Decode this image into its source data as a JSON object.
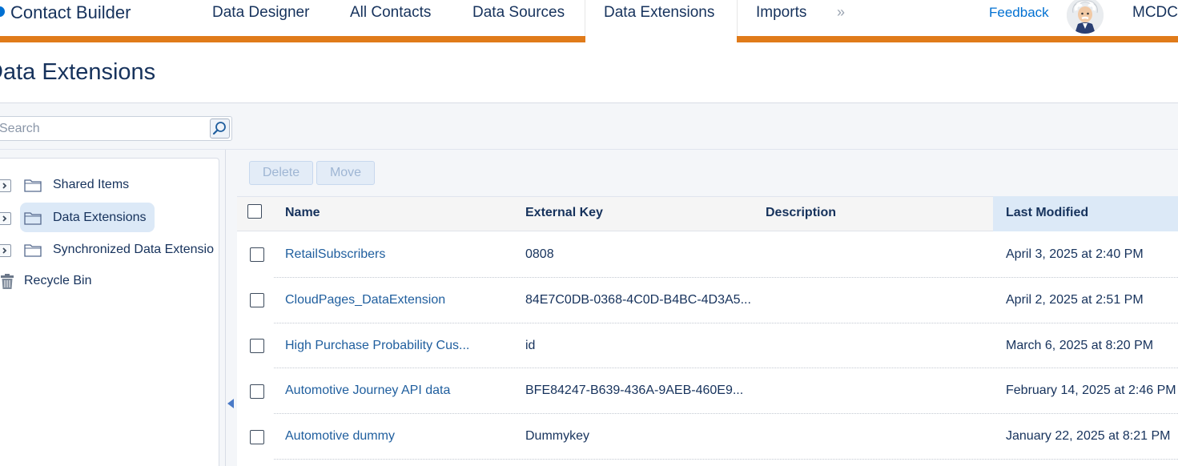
{
  "app": {
    "title": "Contact Builder",
    "account": "MCDC"
  },
  "nav": {
    "tabs": [
      {
        "label": "Data Designer"
      },
      {
        "label": "All Contacts"
      },
      {
        "label": "Data Sources"
      },
      {
        "label": "Data Extensions",
        "active": true
      },
      {
        "label": "Imports"
      }
    ],
    "more": "»",
    "feedback": "Feedback"
  },
  "page": {
    "title": "Data Extensions"
  },
  "search": {
    "placeholder": "Search",
    "value": ""
  },
  "sidebar": {
    "items": [
      {
        "label": "Shared Items",
        "expandable": true
      },
      {
        "label": "Data Extensions",
        "expandable": true,
        "selected": true
      },
      {
        "label": "Synchronized Data Extensio",
        "expandable": true
      },
      {
        "label": "Recycle Bin",
        "expandable": false
      }
    ]
  },
  "toolbar": {
    "delete_label": "Delete",
    "move_label": "Move"
  },
  "grid": {
    "columns": {
      "name": "Name",
      "external_key": "External Key",
      "description": "Description",
      "last_modified": "Last Modified"
    },
    "sorted_column": "Last Modified",
    "rows": [
      {
        "name": "RetailSubscribers",
        "external_key": "0808",
        "description": "",
        "last_modified": "April 3, 2025 at 2:40 PM"
      },
      {
        "name": "CloudPages_DataExtension",
        "external_key": "84E7C0DB-0368-4C0D-B4BC-4D3A5...",
        "description": "",
        "last_modified": "April 2, 2025 at 2:51 PM"
      },
      {
        "name": "High Purchase Probability Cus...",
        "external_key": "id",
        "description": "",
        "last_modified": "March 6, 2025 at 8:20 PM"
      },
      {
        "name": "Automotive Journey API data",
        "external_key": "BFE84247-B639-436A-9AEB-460E9...",
        "description": "",
        "last_modified": "February 14, 2025 at 2:46 PM"
      },
      {
        "name": "Automotive dummy",
        "external_key": "Dummykey",
        "description": "",
        "last_modified": "January 22, 2025 at 8:21 PM"
      }
    ]
  },
  "colors": {
    "accent_orange": "#e07b1a",
    "link_blue": "#1f5e9e",
    "brand_blue": "#0070d2",
    "text_dark": "#16325c",
    "selection_blue": "#dce9f7"
  },
  "icons": {
    "search": "search-icon",
    "folder": "folder-icon",
    "expand": "chevron-right-icon",
    "recycle": "trash-icon",
    "collapse_panel": "triangle-left-icon"
  }
}
